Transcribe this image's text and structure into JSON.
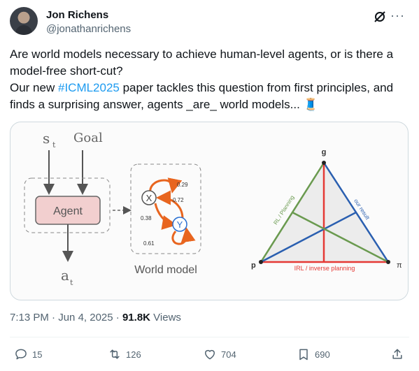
{
  "author": {
    "name": "Jon Richens",
    "handle": "@jonathanrichens"
  },
  "tweet": {
    "line1": "Are world models necessary to achieve human-level agents, or is there a model-free short-cut?",
    "line2_before": "Our new ",
    "hashtag": "#ICML2025",
    "line2_after": " paper tackles this question from first principles, and finds a surprising answer, agents _are_ world models...",
    "emoji": "🧵"
  },
  "figure_left": {
    "state_label": "s",
    "state_sub": "t",
    "goal_label": "Goal",
    "agent_label": "Agent",
    "action_label": "a",
    "action_sub": "t",
    "node_x": "X",
    "node_y": "Y",
    "p1": "0.29",
    "p2": "0.72",
    "p3": "0.38",
    "p4": "0.61",
    "world_model_label": "World model"
  },
  "figure_right": {
    "vertex_top": "g",
    "vertex_left": "p",
    "vertex_right": "π",
    "edge_left": "RL / Planning",
    "edge_right": "our result",
    "edge_bottom": "IRL / inverse planning",
    "colors": {
      "green": "#6a9a4f",
      "blue": "#2a5fb0",
      "red": "#e53935"
    }
  },
  "meta": {
    "time": "7:13 PM",
    "sep": "·",
    "date": "Jun 4, 2025",
    "views_count": "91.8K",
    "views_label": "Views"
  },
  "actions": {
    "replies": "15",
    "reposts": "126",
    "likes": "704",
    "bookmarks": "690"
  },
  "icons": [
    "grok-icon",
    "more-icon",
    "reply-icon",
    "repost-icon",
    "like-icon",
    "bookmark-icon",
    "share-icon"
  ]
}
